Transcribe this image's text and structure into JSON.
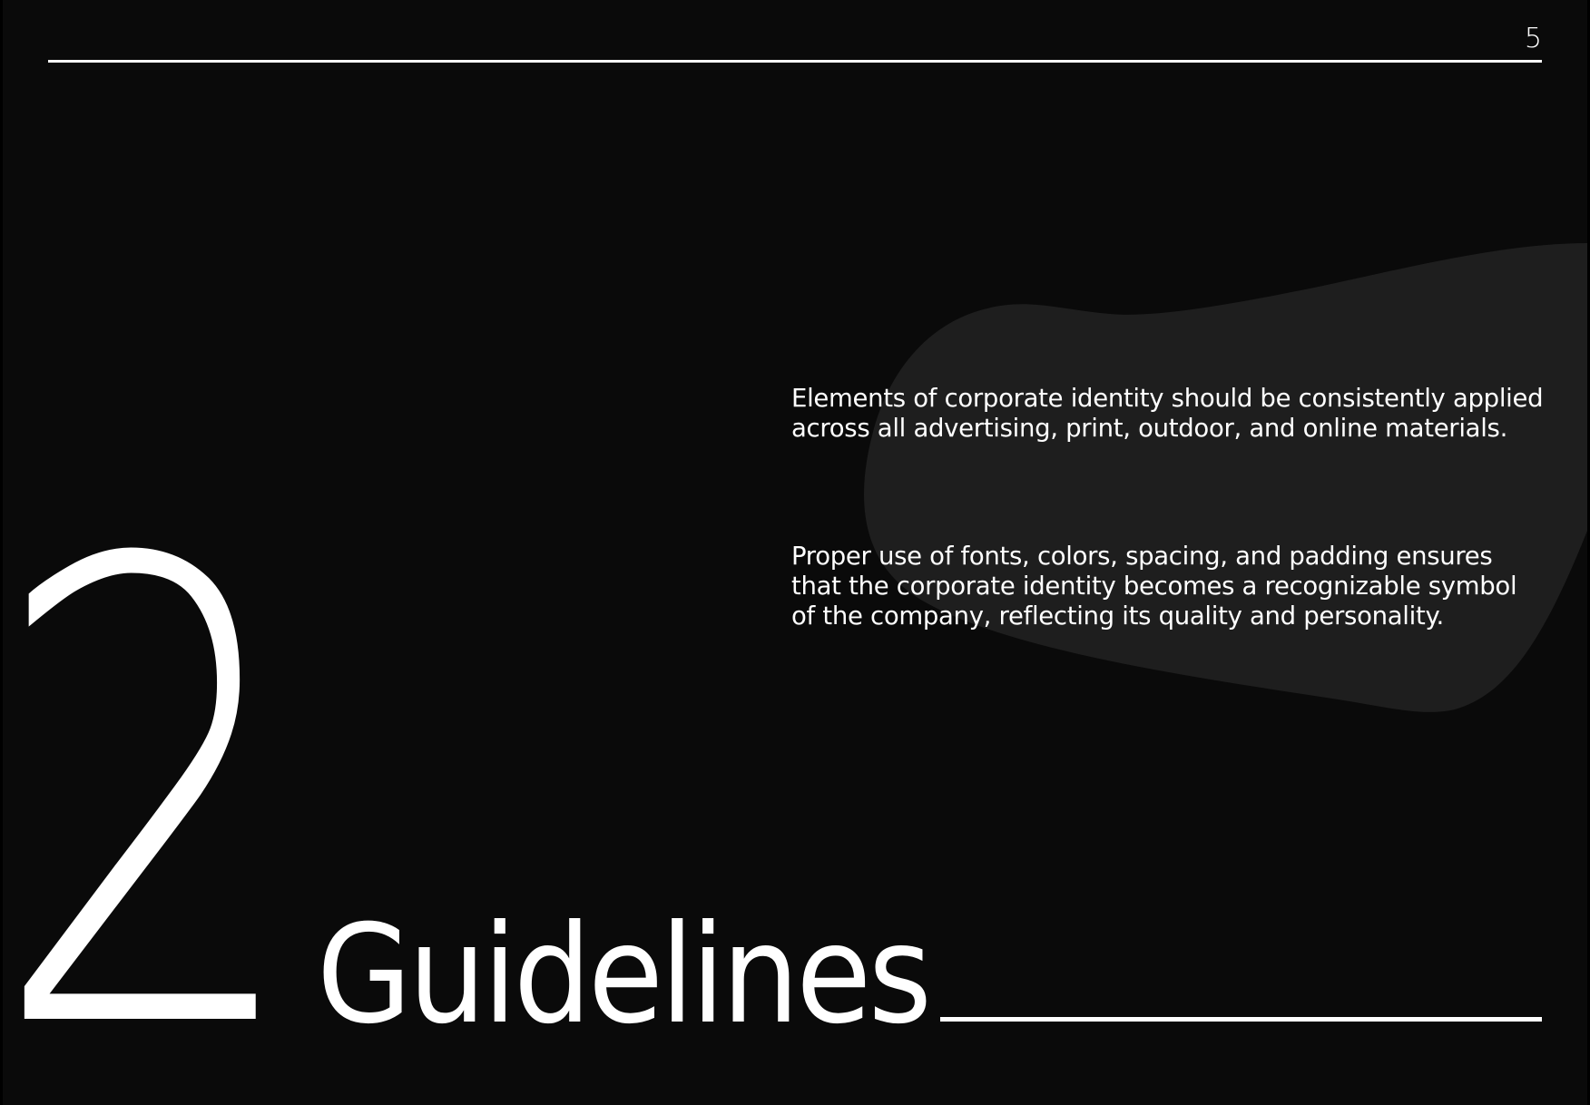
{
  "page": {
    "number": "5",
    "section_number": "2",
    "title": "Guidelines",
    "paragraphs": [
      "Elements of corporate identity should be consistently applied across all advertising, print, outdoor, and online materials.",
      "Proper use of fonts, colors, spacing, and padding ensures that the corporate identity becomes a recognizable symbol of the company, reflecting its quality and personality."
    ]
  },
  "colors": {
    "background": "#0a0a0a",
    "blob": "#1e1e1e",
    "text": "#ffffff"
  }
}
